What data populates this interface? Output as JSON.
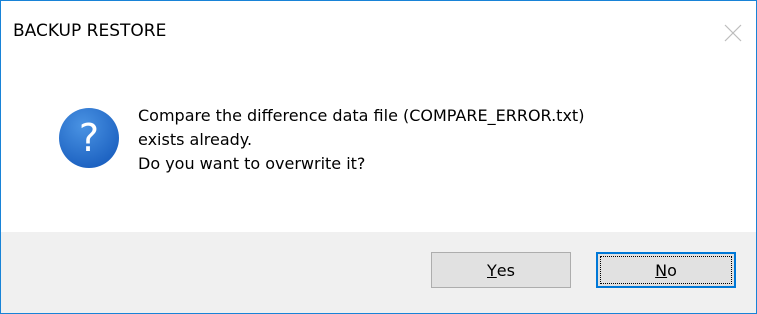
{
  "window": {
    "title": "BACKUP RESTORE",
    "close_icon": "close-icon"
  },
  "message": {
    "icon": "question-icon",
    "icon_glyph": "?",
    "lines": [
      "Compare the difference data file (COMPARE_ERROR.txt)",
      "exists already.",
      "Do you want to overwrite it?"
    ]
  },
  "buttons": {
    "yes": {
      "mnemonic": "Y",
      "rest": "es"
    },
    "no": {
      "mnemonic": "N",
      "rest": "o",
      "default": true
    }
  },
  "colors": {
    "border": "#1883d7",
    "icon_blue": "#1f6fd0",
    "footer_bg": "#f0f0f0",
    "button_bg": "#e1e1e1",
    "default_button_border": "#0078d7"
  }
}
